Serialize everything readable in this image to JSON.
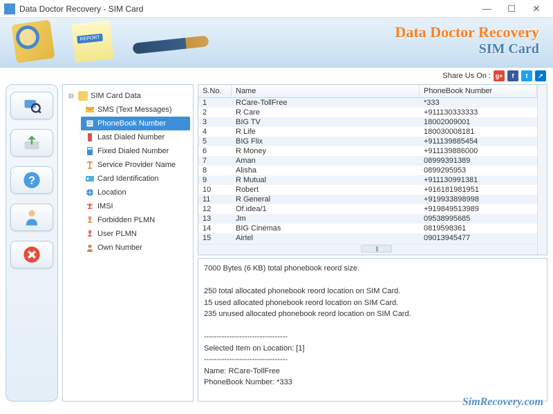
{
  "window": {
    "title": "Data Doctor Recovery - SIM Card"
  },
  "banner": {
    "line1": "Data Doctor Recovery",
    "line2": "SIM Card"
  },
  "sharebar": {
    "label": "Share Us On :"
  },
  "tree": {
    "root": "SIM Card Data",
    "items": [
      {
        "label": "SMS (Text Messages)",
        "icon": "envelope",
        "color": "#f6c244"
      },
      {
        "label": "PhoneBook Number",
        "icon": "book",
        "color": "#3d8fd9",
        "selected": true
      },
      {
        "label": "Last Dialed Number",
        "icon": "phone",
        "color": "#d9534f"
      },
      {
        "label": "Fixed Dialed Number",
        "icon": "calc",
        "color": "#3d8fd9"
      },
      {
        "label": "Service Provider Name",
        "icon": "tower",
        "color": "#d9843f"
      },
      {
        "label": "Card Identification",
        "icon": "id",
        "color": "#50aee0"
      },
      {
        "label": "Location",
        "icon": "globe",
        "color": "#3d8fd9"
      },
      {
        "label": "IMSI",
        "icon": "imsi",
        "color": "#d9534f"
      },
      {
        "label": "Forbidden PLMN",
        "icon": "fplmn",
        "color": "#d9843f"
      },
      {
        "label": "User PLMN",
        "icon": "uplmn",
        "color": "#d9534f"
      },
      {
        "label": "Own Number",
        "icon": "user",
        "color": "#d9843f"
      }
    ]
  },
  "table": {
    "headers": {
      "sno": "S.No.",
      "name": "Name",
      "number": "PhoneBook Number"
    },
    "rows": [
      {
        "sno": "1",
        "name": "RCare-TollFree",
        "number": "*333"
      },
      {
        "sno": "2",
        "name": "R Care",
        "number": "+911130333333"
      },
      {
        "sno": "3",
        "name": "BIG TV",
        "number": "18002009001"
      },
      {
        "sno": "4",
        "name": "R Life",
        "number": "180030008181"
      },
      {
        "sno": "5",
        "name": "BIG Flix",
        "number": "+911139885454"
      },
      {
        "sno": "6",
        "name": "R Money",
        "number": "+911139886000"
      },
      {
        "sno": "7",
        "name": "Aman",
        "number": "08999391389"
      },
      {
        "sno": "8",
        "name": "Alisha",
        "number": "0899295953"
      },
      {
        "sno": "9",
        "name": "R Mutual",
        "number": "+911130991381"
      },
      {
        "sno": "10",
        "name": "Robert",
        "number": "+916181981951"
      },
      {
        "sno": "11",
        "name": "R General",
        "number": "+919933898998"
      },
      {
        "sno": "12",
        "name": "Of.idea/1",
        "number": "+919849513989"
      },
      {
        "sno": "13",
        "name": "Jm",
        "number": "09538995685"
      },
      {
        "sno": "14",
        "name": "BIG Cinemas",
        "number": "0819598361"
      },
      {
        "sno": "15",
        "name": "Airtel",
        "number": "09013945477"
      }
    ]
  },
  "details": {
    "text": "7000 Bytes (6 KB) total phonebook reord size.\n\n250 total allocated phonebook reord location on SIM Card.\n15 used allocated phonebook reord location on SIM Card.\n235 unused allocated phonebook reord location on SIM Card.\n\n---------------------------------\nSelected Item on Location: [1]\n---------------------------------\nName:                              RCare-TollFree\nPhoneBook Number:          *333"
  },
  "footer": {
    "text": "SimRecovery.com"
  }
}
